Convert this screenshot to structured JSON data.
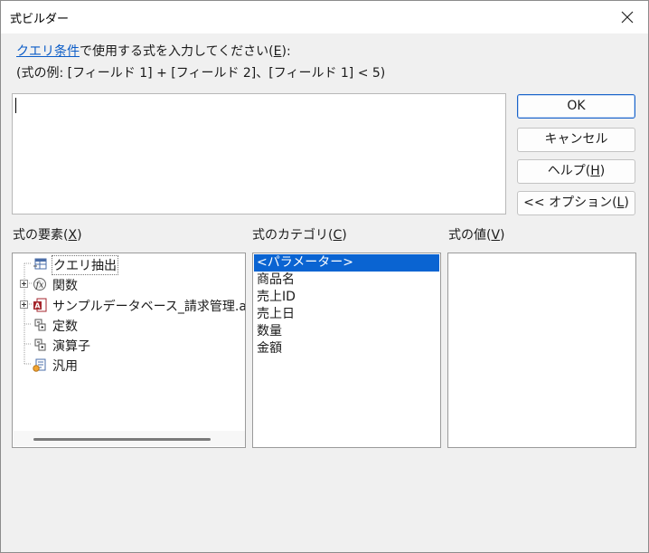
{
  "window": {
    "title": "式ビルダー"
  },
  "prompt": {
    "link": "クエリ条件",
    "text": "で使用する式を入力してください(",
    "accel": "E",
    "end": "):"
  },
  "example": "(式の例: [フィールド 1] + [フィールド 2]、[フィールド 1] < 5)",
  "expression": {
    "value": ""
  },
  "buttons": {
    "ok": "OK",
    "cancel": "キャンセル",
    "help": {
      "text": "ヘルプ(",
      "accel": "H",
      "end": ")"
    },
    "options": {
      "text": "<< オプション(",
      "accel": "L",
      "end": ")"
    }
  },
  "panels": {
    "elements": {
      "label": {
        "text": "式の要素(",
        "accel": "X",
        "end": ")"
      },
      "items": [
        {
          "label": "クエリ抽出",
          "icon": "query-icon",
          "expandable": false,
          "selected": true
        },
        {
          "label": "関数",
          "icon": "function-icon",
          "expandable": true,
          "selected": false
        },
        {
          "label": "サンプルデータベース_請求管理.accdb",
          "icon": "database-icon",
          "expandable": true,
          "selected": false
        },
        {
          "label": "定数",
          "icon": "constants-icon",
          "expandable": false,
          "selected": false
        },
        {
          "label": "演算子",
          "icon": "operators-icon",
          "expandable": false,
          "selected": false
        },
        {
          "label": "汎用",
          "icon": "common-icon",
          "expandable": false,
          "selected": false
        }
      ]
    },
    "categories": {
      "label": {
        "text": "式のカテゴリ(",
        "accel": "C",
        "end": ")"
      },
      "items": [
        {
          "label": "<パラメーター>",
          "selected": true
        },
        {
          "label": "商品名",
          "selected": false
        },
        {
          "label": "売上ID",
          "selected": false
        },
        {
          "label": "売上日",
          "selected": false
        },
        {
          "label": "数量",
          "selected": false
        },
        {
          "label": "金額",
          "selected": false
        }
      ]
    },
    "values": {
      "label": {
        "text": "式の値(",
        "accel": "V",
        "end": ")"
      },
      "items": []
    }
  },
  "colors": {
    "accent": "#0a64d2",
    "link": "#0b5cc7",
    "background": "#f0f0f0"
  }
}
